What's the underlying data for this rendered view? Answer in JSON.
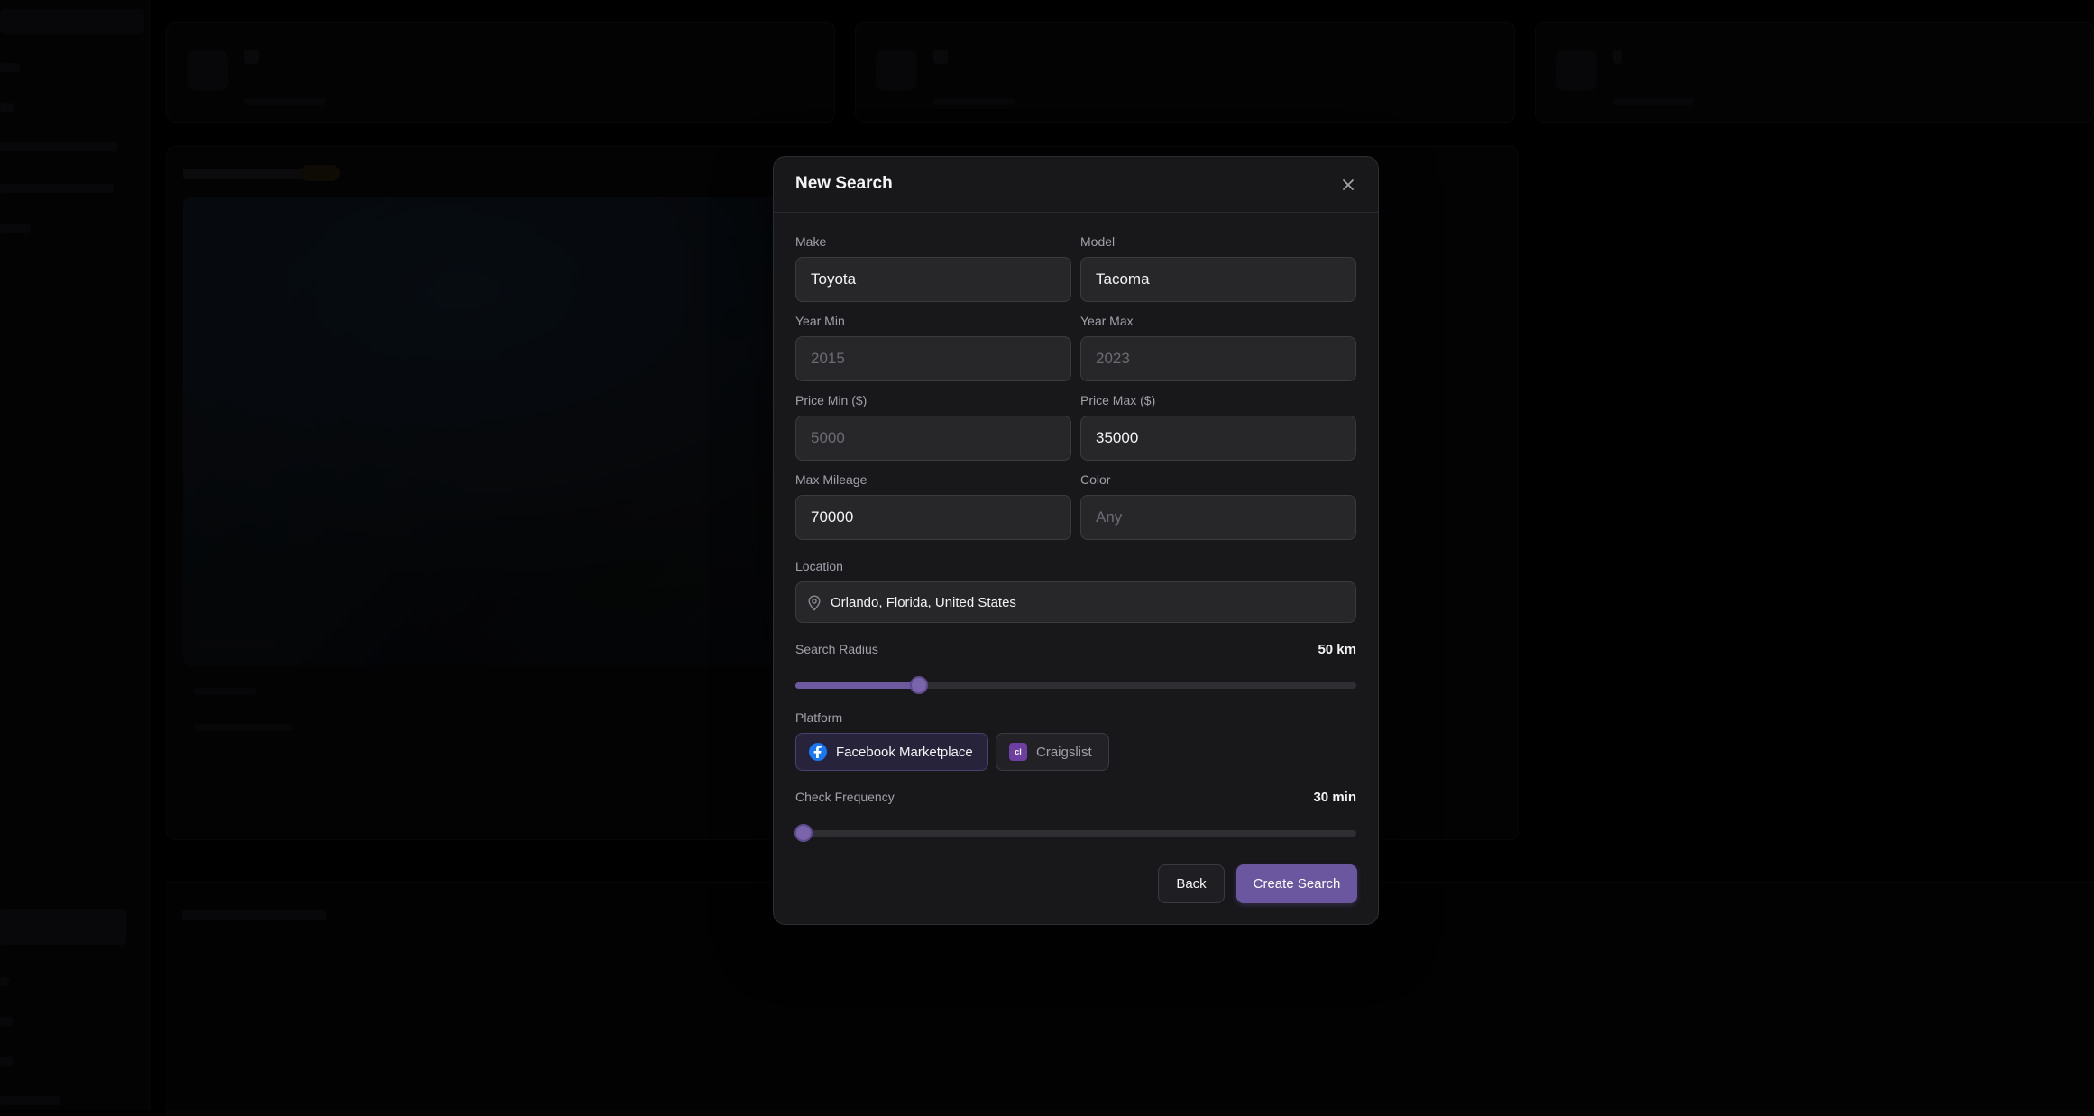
{
  "modal": {
    "title": "New Search",
    "fields": {
      "make": {
        "label": "Make",
        "value": "Toyota",
        "placeholder": ""
      },
      "model": {
        "label": "Model",
        "value": "Tacoma",
        "placeholder": ""
      },
      "year_min": {
        "label": "Year Min",
        "value": "",
        "placeholder": "2015"
      },
      "year_max": {
        "label": "Year Max",
        "value": "",
        "placeholder": "2023"
      },
      "price_min": {
        "label": "Price Min ($)",
        "value": "",
        "placeholder": "5000"
      },
      "price_max": {
        "label": "Price Max ($)",
        "value": "35000",
        "placeholder": ""
      },
      "max_mileage": {
        "label": "Max Mileage",
        "value": "70000",
        "placeholder": ""
      },
      "color": {
        "label": "Color",
        "value": "",
        "placeholder": "Any"
      }
    },
    "location": {
      "label": "Location",
      "value": "Orlando, Florida, United States",
      "icon": "map-pin-icon"
    },
    "search_radius": {
      "label": "Search Radius",
      "value_text": "50 km",
      "fraction": 0.22
    },
    "platform": {
      "label": "Platform",
      "options": [
        {
          "label": "Facebook Marketplace",
          "icon": "facebook-icon",
          "selected": true
        },
        {
          "label": "Craigslist",
          "icon": "craigslist-icon",
          "selected": false
        }
      ]
    },
    "check_frequency": {
      "label": "Check Frequency",
      "value_text": "30 min",
      "fraction": 0.015
    },
    "buttons": {
      "back": "Back",
      "create": "Create Search"
    }
  },
  "colors": {
    "accent": "#6b57a0",
    "modal_bg": "#18181b",
    "input_bg": "#27272a",
    "facebook_blue": "#1877f2",
    "craigslist_purple": "#6e3fa3"
  }
}
